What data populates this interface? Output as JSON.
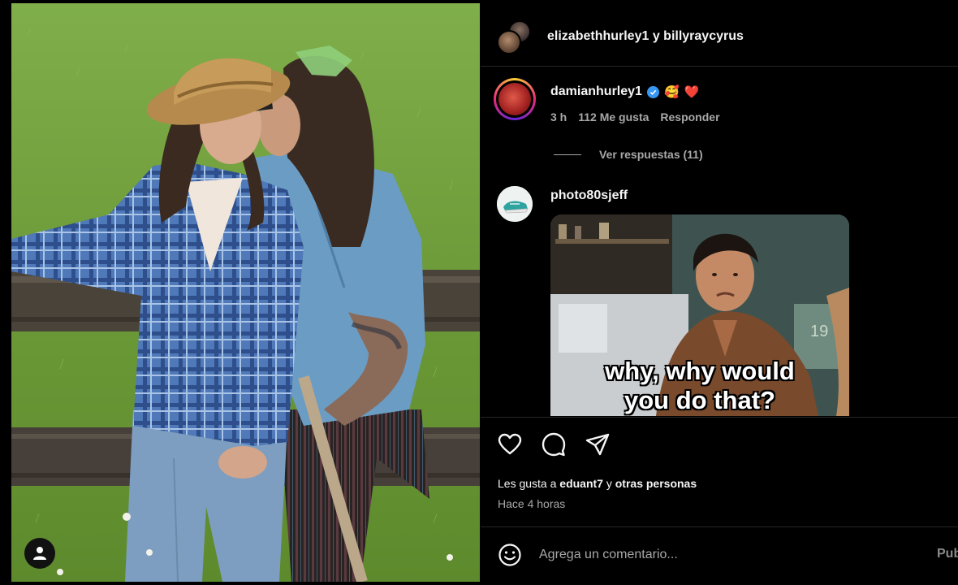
{
  "photo": {
    "alt_icon": "user-tag-icon"
  },
  "header": {
    "users": "elizabethhurley1 y billyraycyrus"
  },
  "comment1": {
    "username": "damianhurley1",
    "verified_icon": "verified-badge-icon",
    "emoji_1": "🥰",
    "emoji_2": "❤️",
    "time": "3 h",
    "likes": "112 Me gusta",
    "reply": "Responder",
    "view_replies": "Ver respuestas (11)"
  },
  "comment2": {
    "username": "photo80sjeff",
    "gif_caption_line1": "why, why would",
    "gif_caption_line2": "you do that?"
  },
  "actions": {
    "icons": [
      "heart-icon",
      "comment-icon",
      "share-icon"
    ]
  },
  "likes_line": {
    "prefix": "Les gusta a",
    "user": "eduant7",
    "middle": "y",
    "others": "otras personas"
  },
  "timestamp": "Hace 4 horas",
  "comment_input": {
    "placeholder": "Agrega un comentario...",
    "publish": "Publicar"
  },
  "colors": {
    "background": "#000000",
    "muted_text": "#a8a8a8",
    "verified": "#3897f0",
    "divider": "#262626"
  }
}
